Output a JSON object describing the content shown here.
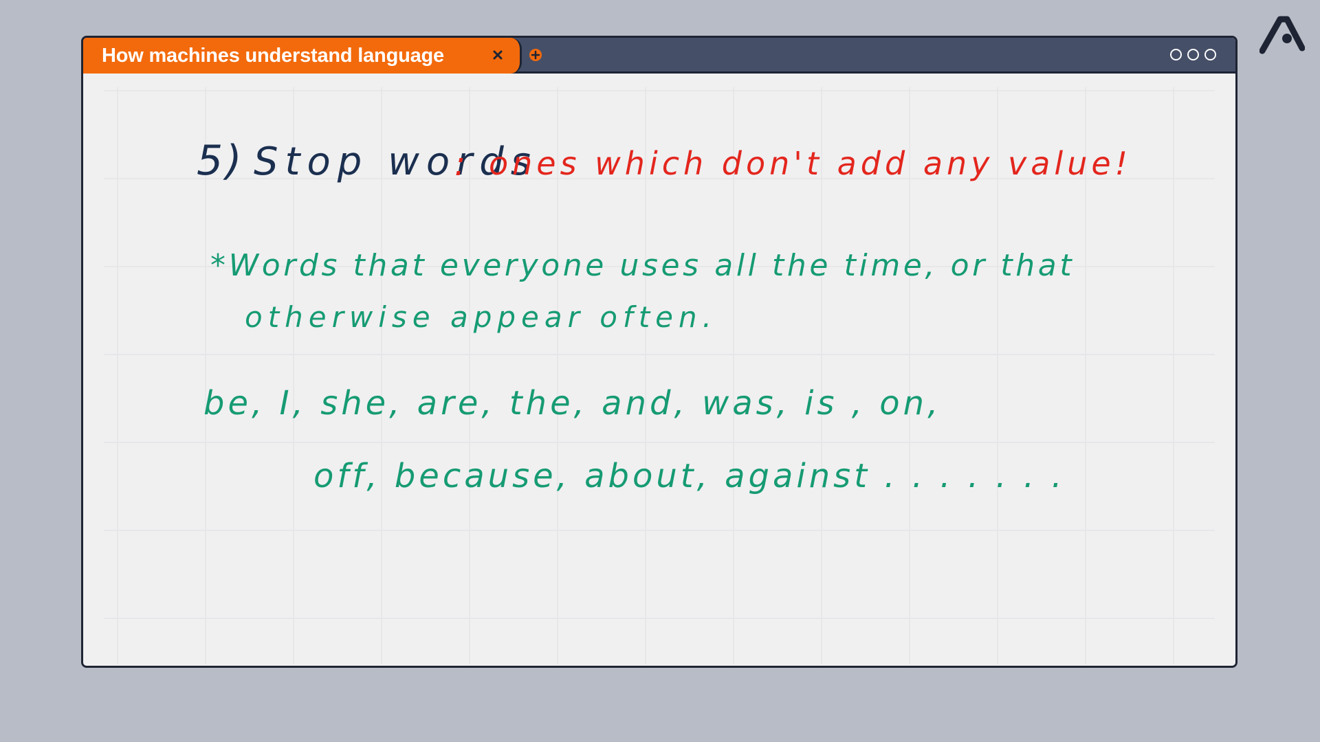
{
  "window": {
    "tab_title": "How machines understand language"
  },
  "note": {
    "heading_number": "5)",
    "heading_term": "Stop words",
    "heading_colon": ":",
    "heading_definition": "ones which don't add any value!",
    "explanation_line1": "*Words that everyone uses all the time, or that",
    "explanation_line2": "otherwise appear often.",
    "examples_line1": "be,  I,  she,  are,  the,  and,  was,  is ,  on,",
    "examples_line2": "off,  because,  about,  against . . . . . . ."
  },
  "colors": {
    "tab": "#f36a0c",
    "titlebar": "#454f68",
    "ink_heading": "#1b2f4f",
    "ink_definition": "#e3261d",
    "ink_body": "#169b72"
  }
}
